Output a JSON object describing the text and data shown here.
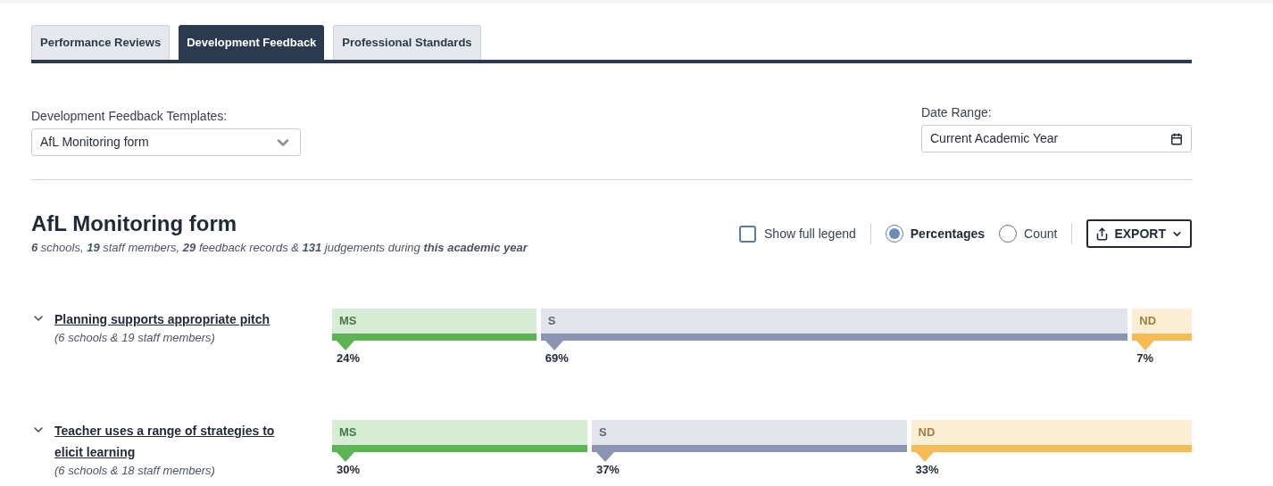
{
  "tabs": [
    {
      "label": "Performance Reviews",
      "selected": false
    },
    {
      "label": "Development Feedback",
      "selected": true
    },
    {
      "label": "Professional Standards",
      "selected": false
    }
  ],
  "filters": {
    "template": {
      "label": "Development Feedback Templates:",
      "value": "AfL Monitoring form"
    },
    "date_range": {
      "label": "Date Range:",
      "value": "Current Academic Year"
    }
  },
  "report": {
    "title": "AfL Monitoring form",
    "summary": "**6** schools, **19** staff members, **29** feedback records & **131** judgements during **this academic year**",
    "show_full_legend": {
      "label": "Show full legend",
      "checked": false
    },
    "display_modes": [
      {
        "label": "Percentages",
        "selected": true
      },
      {
        "label": "Count",
        "selected": false
      }
    ],
    "export_button": "EXPORT"
  },
  "criteria": [
    {
      "title": "Planning supports appropriate pitch",
      "subtitle": "(6 schools & 19 staff members)",
      "expanded": false,
      "segments": [
        {
          "label": "MS",
          "reading": "24%",
          "color": "#5cb452"
        },
        {
          "label": "S",
          "reading": "69%",
          "color": "#8b94b0"
        },
        {
          "label": "ND",
          "reading": "7%",
          "color": "#f5bc55"
        }
      ]
    },
    {
      "title": "Teacher uses a range of strategies to elicit learning",
      "subtitle": "(6 schools & 18 staff members)",
      "expanded": false,
      "segments": [
        {
          "label": "MS",
          "reading": "30%",
          "color": "#5cb452"
        },
        {
          "label": "S",
          "reading": "37%",
          "color": "#8b94b0"
        },
        {
          "label": "ND",
          "reading": "33%",
          "color": "#f5bc55"
        }
      ]
    }
  ]
}
